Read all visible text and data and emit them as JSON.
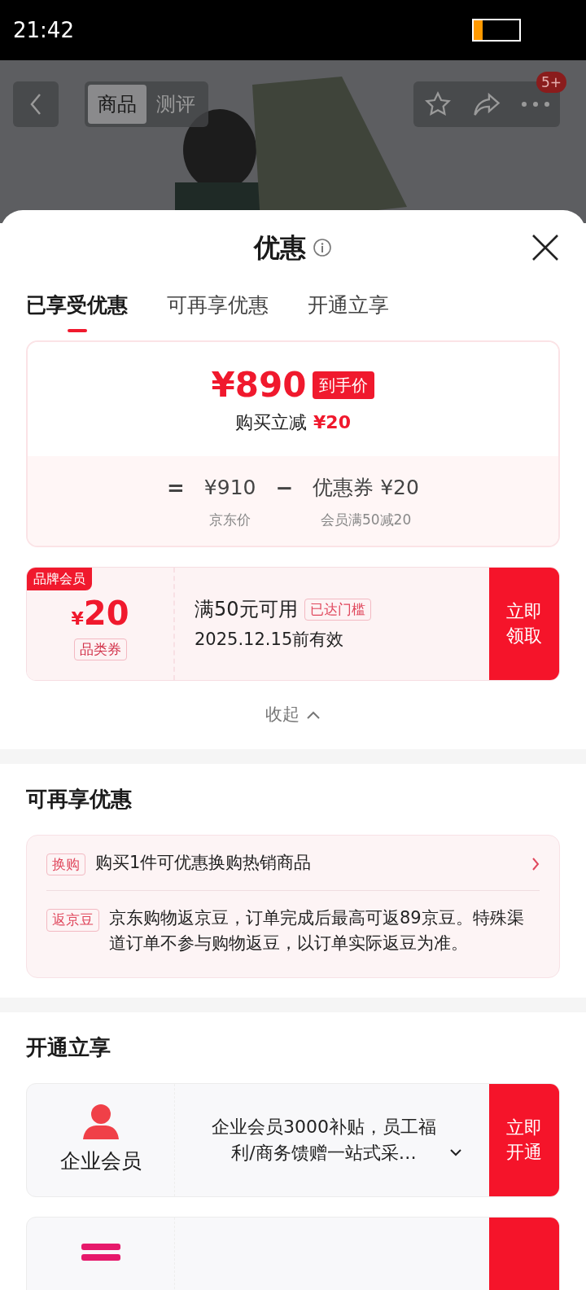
{
  "status_bar": {
    "time": "21:42",
    "battery": {
      "level": 0.2
    }
  },
  "top_nav": {
    "tabs": [
      {
        "label": "商品",
        "selected": true
      },
      {
        "label": "测评",
        "selected": false
      }
    ],
    "badge": "5+"
  },
  "sheet": {
    "title": "优惠",
    "tabs": [
      {
        "label": "已享受优惠",
        "selected": true
      },
      {
        "label": "可再享优惠",
        "selected": false
      },
      {
        "label": "开通立享",
        "selected": false
      }
    ],
    "price_card": {
      "price": "¥890",
      "price_tag": "到手价",
      "discount_label": "购买立减",
      "discount_amount": "¥20",
      "equals": "=",
      "base_price": "¥910",
      "base_label": "京东价",
      "minus": "−",
      "coupon_price": "优惠券 ¥20",
      "coupon_label": "会员满50减20"
    },
    "coupon": {
      "corner_tag": "品牌会员",
      "currency": "¥",
      "amount": "20",
      "type_tag": "品类券",
      "condition": "满50元可用",
      "status_tag": "已达门槛",
      "validity": "2025.12.15前有效",
      "button": "立即领取"
    },
    "collapse": "收起",
    "more_section": {
      "heading": "可再享优惠",
      "items": [
        {
          "tag": "换购",
          "text": "购买1件可优惠换购热销商品",
          "has_arrow": true
        },
        {
          "tag": "返京豆",
          "text": "京东购物返京豆，订单完成后最高可返89京豆。特殊渠道订单不参与购物返豆，以订单实际返豆为准。",
          "has_arrow": false
        }
      ]
    },
    "open_section": {
      "heading": "开通立享",
      "cards": [
        {
          "kind": "member",
          "name": "企业会员",
          "text": "企业会员3000补贴，员工福利/商务馈赠一站式采…",
          "button": "立即开通"
        },
        {
          "kind": "partial"
        }
      ]
    }
  }
}
